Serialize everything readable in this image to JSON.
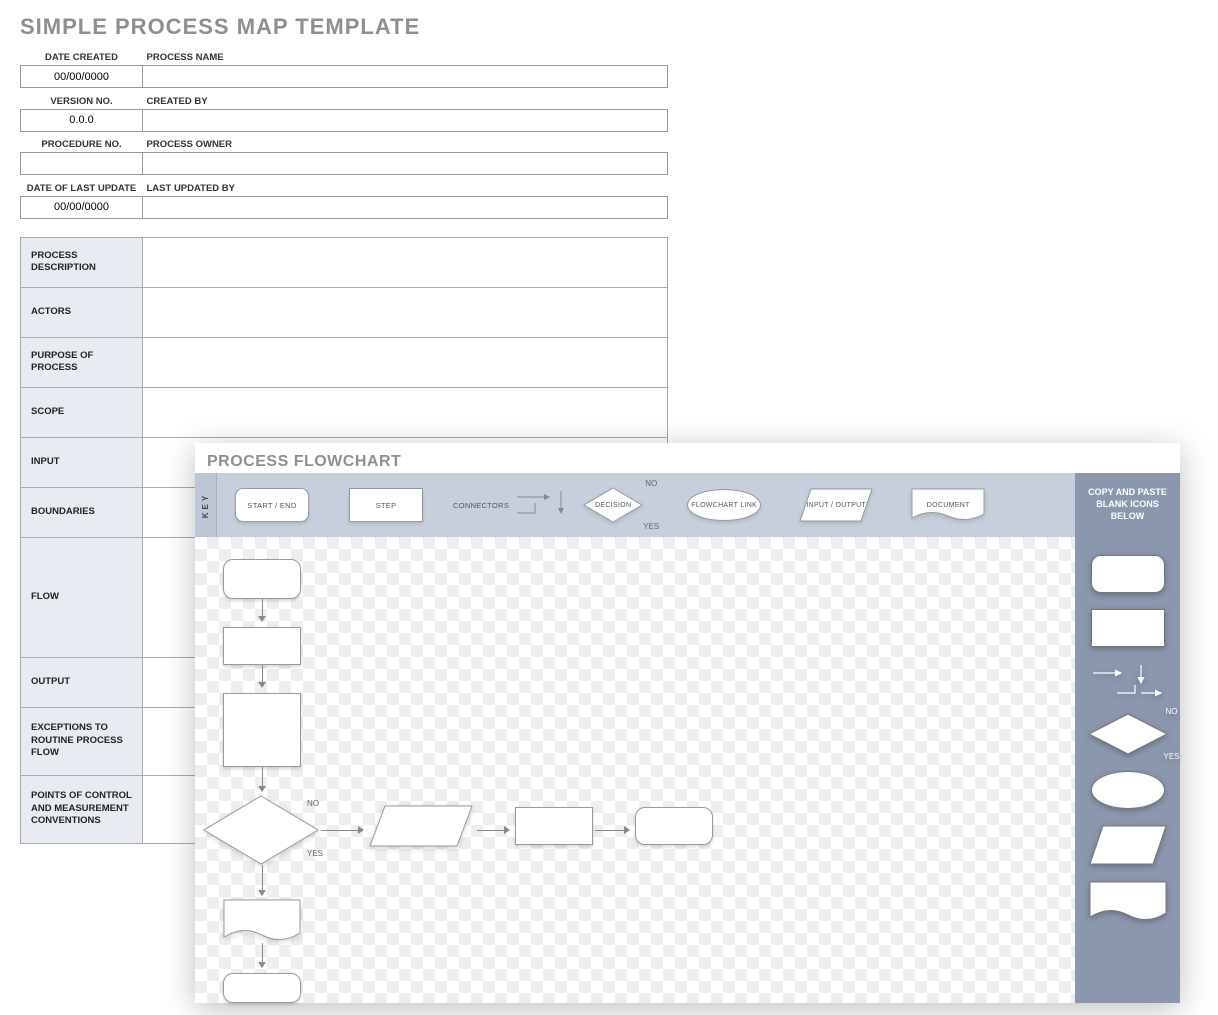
{
  "title": "SIMPLE PROCESS MAP TEMPLATE",
  "meta": {
    "date_created": {
      "label": "DATE CREATED",
      "value": "00/00/0000"
    },
    "process_name": {
      "label": "PROCESS NAME",
      "value": ""
    },
    "version_no": {
      "label": "VERSION NO.",
      "value": "0.0.0"
    },
    "created_by": {
      "label": "CREATED BY",
      "value": ""
    },
    "procedure_no": {
      "label": "PROCEDURE NO.",
      "value": ""
    },
    "process_owner": {
      "label": "PROCESS OWNER",
      "value": ""
    },
    "date_last": {
      "label": "DATE OF LAST UPDATE",
      "value": "00/00/0000"
    },
    "last_by": {
      "label": "LAST UPDATED BY",
      "value": ""
    }
  },
  "desc": {
    "process_description": "PROCESS DESCRIPTION",
    "actors": "ACTORS",
    "purpose": "PURPOSE OF PROCESS",
    "scope": "SCOPE",
    "input": "INPUT",
    "boundaries": "BOUNDARIES",
    "flow": "FLOW",
    "output": "OUTPUT",
    "exceptions": "EXCEPTIONS TO ROUTINE PROCESS FLOW",
    "points": "POINTS OF CONTROL AND MEASUREMENT CONVENTIONS"
  },
  "flowchart": {
    "title": "PROCESS FLOWCHART",
    "key_tab": "KEY",
    "copy_banner": "COPY AND PASTE BLANK ICONS BELOW",
    "shapes": {
      "terminator": "START / END",
      "step": "STEP",
      "connectors": "CONNECTORS",
      "decision": "DECISION",
      "decision_no": "NO",
      "decision_yes": "YES",
      "link": "FLOWCHART LINK",
      "io": "INPUT / OUTPUT",
      "document": "DOCUMENT"
    },
    "canvas_labels": {
      "no": "NO",
      "yes": "YES"
    }
  }
}
